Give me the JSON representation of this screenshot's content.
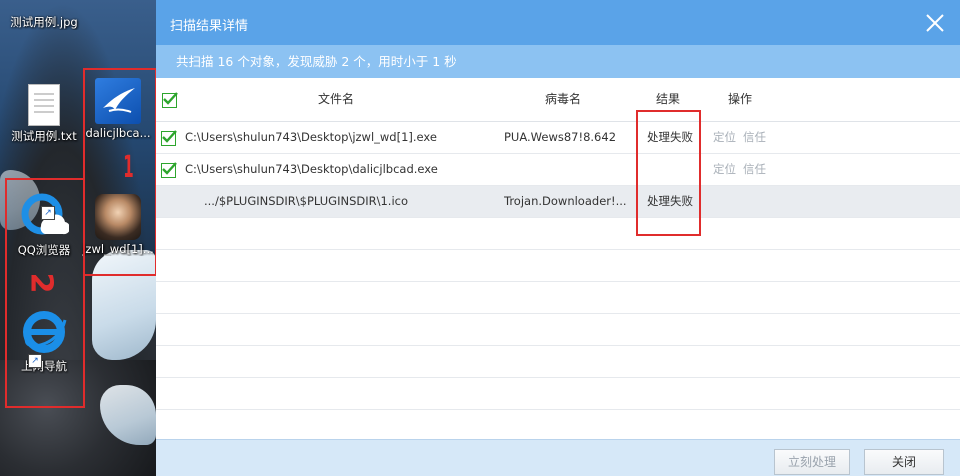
{
  "desktop": {
    "icons": [
      {
        "label": "测试用例.jpg"
      },
      {
        "label": "测试用例.txt"
      },
      {
        "label": "dalicjlbca..."
      },
      {
        "label": "QQ浏览器"
      },
      {
        "label": "jzwl_wd[1]..."
      },
      {
        "label": "上网导航"
      }
    ],
    "annotation_numbers": [
      "1",
      "2"
    ]
  },
  "dialog": {
    "title": "扫描结果详情",
    "summary": "共扫描 16 个对象，发现威胁 2 个，用时小于 1 秒",
    "headers": {
      "filename": "文件名",
      "virus": "病毒名",
      "result": "结果",
      "action": "操作"
    },
    "rows": [
      {
        "file": "C:\\Users\\shulun743\\Desktop\\jzwl_wd[1].exe",
        "virus": "PUA.Wews87!8.642",
        "result": "处理失败",
        "locate": "定位",
        "trust": "信任"
      },
      {
        "file": "C:\\Users\\shulun743\\Desktop\\dalicjlbcad.exe",
        "virus": "",
        "result": "",
        "locate": "定位",
        "trust": "信任"
      },
      {
        "file": ".../$PLUGINSDIR\\$PLUGINSDIR\\1.ico",
        "virus": "Trojan.Downloader!...",
        "result": "处理失败"
      }
    ],
    "buttons": {
      "process_now": "立刻处理",
      "close": "关闭"
    }
  },
  "colors": {
    "titlebar": "#5aa3e8",
    "summary_bar": "#8cc2f2",
    "footer": "#d6e8f8",
    "annotation": "#e02c2c",
    "check": "#2da52d"
  }
}
